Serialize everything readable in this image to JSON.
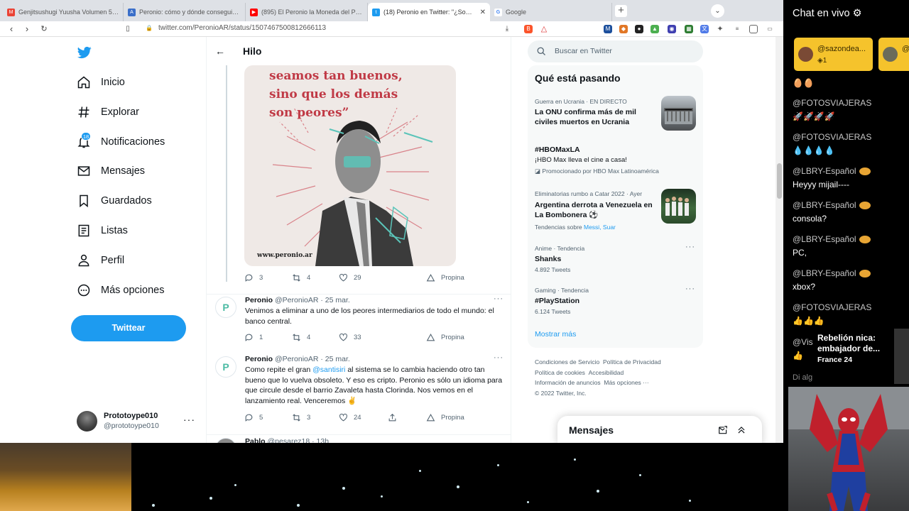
{
  "browser": {
    "tabs": [
      {
        "label": "Genjitsushugi Yuusha Volumen 5 Cap",
        "favicon": "M",
        "color": "#ea4335",
        "active": false
      },
      {
        "label": "Peronio: cómo y dónde conseguir el",
        "favicon": "A",
        "color": "#3b6fc9",
        "active": false
      },
      {
        "label": "(895) El Peronio la Moneda del Pueblo",
        "favicon": "▶",
        "color": "#ff0000",
        "active": false
      },
      {
        "label": "(18) Peronio en Twitter: \"¿Somos",
        "favicon": "t",
        "color": "#1d9bf0",
        "active": true
      },
      {
        "label": "Google",
        "favicon": "G",
        "color": "#4285f4",
        "active": false
      }
    ],
    "url": "twitter.com/PeronioAR/status/1507467500812666113"
  },
  "sidebar": {
    "items": [
      {
        "label": "Inicio",
        "icon": "home-icon"
      },
      {
        "label": "Explorar",
        "icon": "hashtag-icon"
      },
      {
        "label": "Notificaciones",
        "icon": "bell-icon"
      },
      {
        "label": "Mensajes",
        "icon": "envelope-icon"
      },
      {
        "label": "Guardados",
        "icon": "bookmark-icon"
      },
      {
        "label": "Listas",
        "icon": "list-icon"
      },
      {
        "label": "Perfil",
        "icon": "person-icon"
      },
      {
        "label": "Más opciones",
        "icon": "more-circle-icon"
      }
    ],
    "notif_count": "18",
    "tweet_button": "Twittear",
    "profile": {
      "name": "Prototoype010",
      "handle": "@prototoype010"
    }
  },
  "thread": {
    "header": "Hilo",
    "image": {
      "quote_lines": [
        "seamos tan buenos,",
        "sino que los demás",
        "son peores”"
      ],
      "web": "www.peronio.ar"
    },
    "image_actions": {
      "replies": "3",
      "retweets": "4",
      "likes": "29",
      "promote": "Propina"
    },
    "tweets": [
      {
        "name": "Peronio",
        "handle": "@PeronioAR · 25 mar.",
        "text": "Venimos a eliminar a uno de los peores intermediarios de todo el mundo: el banco central.",
        "replies": "1",
        "retweets": "4",
        "likes": "33",
        "promote": "Propina"
      },
      {
        "name": "Peronio",
        "handle": "@PeronioAR · 25 mar.",
        "text_before": "Como repite el gran ",
        "mention": "@santisiri",
        "text_after": " al sistema se lo cambia haciendo otro tan bueno que lo vuelva obsoleto. Y eso es cripto. Peronio es sólo un idioma para que circule desde el barrio Zavaleta hasta Clorinda. Nos vemos en el lanzamiento real. Venceremos ✌",
        "replies": "5",
        "retweets": "3",
        "likes": "24",
        "promote": "Propina"
      },
      {
        "name": "Pablo",
        "handle": "@pesarez18 · 13h"
      }
    ]
  },
  "right": {
    "search_placeholder": "Buscar en Twitter",
    "trends_title": "Qué está pasando",
    "trends": [
      {
        "meta": "Guerra en Ucrania · EN DIRECTO",
        "title": "La ONU confirma más de mil civiles muertos en Ucrania"
      },
      {
        "meta": "",
        "title": "#HBOMaxLA",
        "sub": "¡HBO Max lleva el cine a casa!",
        "promo": "Promocionado por HBO Max Latinoamérica"
      },
      {
        "meta": "Eliminatorias rumbo a Catar 2022 · Ayer",
        "title": "Argentina derrota a Venezuela en La Bombonera ⚽",
        "trending_with": "Tendencias sobre ",
        "links": "Messi, Suar"
      },
      {
        "meta": "Anime · Tendencia",
        "title": "Shanks",
        "count": "4.892 Tweets"
      },
      {
        "meta": "Gaming · Tendencia",
        "title": "#PlayStation",
        "count": "6.124 Tweets"
      }
    ],
    "show_more": "Mostrar más",
    "footer": [
      "Condiciones de Servicio",
      "Política de Privacidad",
      "Política de cookies",
      "Accesibilidad",
      "Información de anuncios",
      "Más opciones ···",
      "© 2022 Twitter, Inc."
    ],
    "messages_drawer": "Mensajes"
  },
  "chat": {
    "title": "Chat en vivo",
    "chips": [
      {
        "user": "@sazondea...",
        "count": "1"
      },
      {
        "user": "@",
        "count": ""
      }
    ],
    "messages": [
      {
        "user": "",
        "text": "🥚🥚"
      },
      {
        "user": "@FOTOSVIAJERAS",
        "text": "🚀🚀🚀🚀"
      },
      {
        "user": "@FOTOSVIAJERAS",
        "text": "💧💧💧💧"
      },
      {
        "user": "@LBRY-Español",
        "text": "Heyyy mijail----"
      },
      {
        "user": "@LBRY-Español",
        "text": "consola?"
      },
      {
        "user": "@LBRY-Español",
        "text": "PC,"
      },
      {
        "user": "@LBRY-Español",
        "text": "xbox?"
      },
      {
        "user": "@FOTOSVIAJERAS",
        "text": "👍👍👍"
      },
      {
        "user": "@Vis",
        "text": "👍"
      },
      {
        "user": "Di alg",
        "text": ""
      }
    ],
    "news": {
      "text": "Rebelión nica: embajador de...",
      "source": "France 24"
    }
  }
}
